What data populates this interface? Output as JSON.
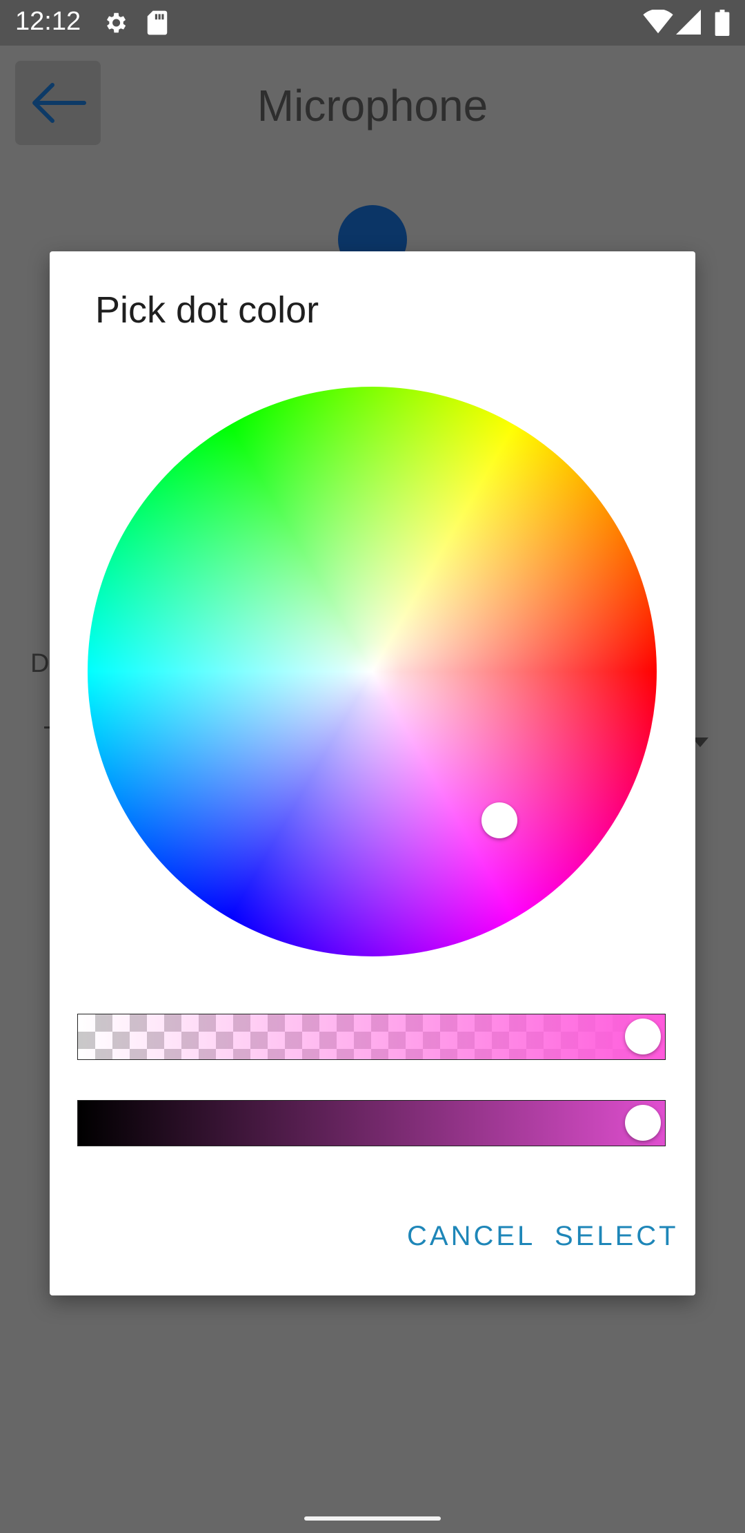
{
  "status_bar": {
    "time": "12:12",
    "icons": [
      "gear-icon",
      "sd-card-icon",
      "wifi-icon",
      "signal-icon",
      "battery-icon"
    ]
  },
  "app": {
    "title": "Microphone",
    "back_icon": "arrow-left-icon",
    "partial_label": "D",
    "dot_color": "#0b3566"
  },
  "dialog": {
    "title": "Pick dot color",
    "cancel_label": "CANCEL",
    "select_label": "SELECT",
    "selected_color": "#ff5ae0",
    "accent_color": "#1e86b8",
    "alpha": 1.0,
    "value": 1.0
  }
}
